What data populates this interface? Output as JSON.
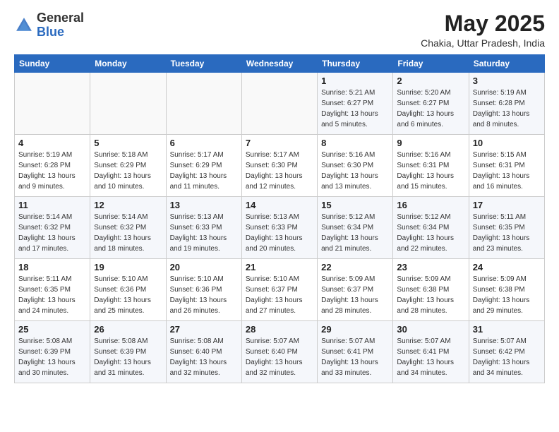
{
  "header": {
    "logo_general": "General",
    "logo_blue": "Blue",
    "month_year": "May 2025",
    "location": "Chakia, Uttar Pradesh, India"
  },
  "weekdays": [
    "Sunday",
    "Monday",
    "Tuesday",
    "Wednesday",
    "Thursday",
    "Friday",
    "Saturday"
  ],
  "weeks": [
    [
      {
        "day": "",
        "sunrise": "",
        "sunset": "",
        "daylight": ""
      },
      {
        "day": "",
        "sunrise": "",
        "sunset": "",
        "daylight": ""
      },
      {
        "day": "",
        "sunrise": "",
        "sunset": "",
        "daylight": ""
      },
      {
        "day": "",
        "sunrise": "",
        "sunset": "",
        "daylight": ""
      },
      {
        "day": "1",
        "sunrise": "Sunrise: 5:21 AM",
        "sunset": "Sunset: 6:27 PM",
        "daylight": "Daylight: 13 hours and 5 minutes."
      },
      {
        "day": "2",
        "sunrise": "Sunrise: 5:20 AM",
        "sunset": "Sunset: 6:27 PM",
        "daylight": "Daylight: 13 hours and 6 minutes."
      },
      {
        "day": "3",
        "sunrise": "Sunrise: 5:19 AM",
        "sunset": "Sunset: 6:28 PM",
        "daylight": "Daylight: 13 hours and 8 minutes."
      }
    ],
    [
      {
        "day": "4",
        "sunrise": "Sunrise: 5:19 AM",
        "sunset": "Sunset: 6:28 PM",
        "daylight": "Daylight: 13 hours and 9 minutes."
      },
      {
        "day": "5",
        "sunrise": "Sunrise: 5:18 AM",
        "sunset": "Sunset: 6:29 PM",
        "daylight": "Daylight: 13 hours and 10 minutes."
      },
      {
        "day": "6",
        "sunrise": "Sunrise: 5:17 AM",
        "sunset": "Sunset: 6:29 PM",
        "daylight": "Daylight: 13 hours and 11 minutes."
      },
      {
        "day": "7",
        "sunrise": "Sunrise: 5:17 AM",
        "sunset": "Sunset: 6:30 PM",
        "daylight": "Daylight: 13 hours and 12 minutes."
      },
      {
        "day": "8",
        "sunrise": "Sunrise: 5:16 AM",
        "sunset": "Sunset: 6:30 PM",
        "daylight": "Daylight: 13 hours and 13 minutes."
      },
      {
        "day": "9",
        "sunrise": "Sunrise: 5:16 AM",
        "sunset": "Sunset: 6:31 PM",
        "daylight": "Daylight: 13 hours and 15 minutes."
      },
      {
        "day": "10",
        "sunrise": "Sunrise: 5:15 AM",
        "sunset": "Sunset: 6:31 PM",
        "daylight": "Daylight: 13 hours and 16 minutes."
      }
    ],
    [
      {
        "day": "11",
        "sunrise": "Sunrise: 5:14 AM",
        "sunset": "Sunset: 6:32 PM",
        "daylight": "Daylight: 13 hours and 17 minutes."
      },
      {
        "day": "12",
        "sunrise": "Sunrise: 5:14 AM",
        "sunset": "Sunset: 6:32 PM",
        "daylight": "Daylight: 13 hours and 18 minutes."
      },
      {
        "day": "13",
        "sunrise": "Sunrise: 5:13 AM",
        "sunset": "Sunset: 6:33 PM",
        "daylight": "Daylight: 13 hours and 19 minutes."
      },
      {
        "day": "14",
        "sunrise": "Sunrise: 5:13 AM",
        "sunset": "Sunset: 6:33 PM",
        "daylight": "Daylight: 13 hours and 20 minutes."
      },
      {
        "day": "15",
        "sunrise": "Sunrise: 5:12 AM",
        "sunset": "Sunset: 6:34 PM",
        "daylight": "Daylight: 13 hours and 21 minutes."
      },
      {
        "day": "16",
        "sunrise": "Sunrise: 5:12 AM",
        "sunset": "Sunset: 6:34 PM",
        "daylight": "Daylight: 13 hours and 22 minutes."
      },
      {
        "day": "17",
        "sunrise": "Sunrise: 5:11 AM",
        "sunset": "Sunset: 6:35 PM",
        "daylight": "Daylight: 13 hours and 23 minutes."
      }
    ],
    [
      {
        "day": "18",
        "sunrise": "Sunrise: 5:11 AM",
        "sunset": "Sunset: 6:35 PM",
        "daylight": "Daylight: 13 hours and 24 minutes."
      },
      {
        "day": "19",
        "sunrise": "Sunrise: 5:10 AM",
        "sunset": "Sunset: 6:36 PM",
        "daylight": "Daylight: 13 hours and 25 minutes."
      },
      {
        "day": "20",
        "sunrise": "Sunrise: 5:10 AM",
        "sunset": "Sunset: 6:36 PM",
        "daylight": "Daylight: 13 hours and 26 minutes."
      },
      {
        "day": "21",
        "sunrise": "Sunrise: 5:10 AM",
        "sunset": "Sunset: 6:37 PM",
        "daylight": "Daylight: 13 hours and 27 minutes."
      },
      {
        "day": "22",
        "sunrise": "Sunrise: 5:09 AM",
        "sunset": "Sunset: 6:37 PM",
        "daylight": "Daylight: 13 hours and 28 minutes."
      },
      {
        "day": "23",
        "sunrise": "Sunrise: 5:09 AM",
        "sunset": "Sunset: 6:38 PM",
        "daylight": "Daylight: 13 hours and 28 minutes."
      },
      {
        "day": "24",
        "sunrise": "Sunrise: 5:09 AM",
        "sunset": "Sunset: 6:38 PM",
        "daylight": "Daylight: 13 hours and 29 minutes."
      }
    ],
    [
      {
        "day": "25",
        "sunrise": "Sunrise: 5:08 AM",
        "sunset": "Sunset: 6:39 PM",
        "daylight": "Daylight: 13 hours and 30 minutes."
      },
      {
        "day": "26",
        "sunrise": "Sunrise: 5:08 AM",
        "sunset": "Sunset: 6:39 PM",
        "daylight": "Daylight: 13 hours and 31 minutes."
      },
      {
        "day": "27",
        "sunrise": "Sunrise: 5:08 AM",
        "sunset": "Sunset: 6:40 PM",
        "daylight": "Daylight: 13 hours and 32 minutes."
      },
      {
        "day": "28",
        "sunrise": "Sunrise: 5:07 AM",
        "sunset": "Sunset: 6:40 PM",
        "daylight": "Daylight: 13 hours and 32 minutes."
      },
      {
        "day": "29",
        "sunrise": "Sunrise: 5:07 AM",
        "sunset": "Sunset: 6:41 PM",
        "daylight": "Daylight: 13 hours and 33 minutes."
      },
      {
        "day": "30",
        "sunrise": "Sunrise: 5:07 AM",
        "sunset": "Sunset: 6:41 PM",
        "daylight": "Daylight: 13 hours and 34 minutes."
      },
      {
        "day": "31",
        "sunrise": "Sunrise: 5:07 AM",
        "sunset": "Sunset: 6:42 PM",
        "daylight": "Daylight: 13 hours and 34 minutes."
      }
    ]
  ]
}
